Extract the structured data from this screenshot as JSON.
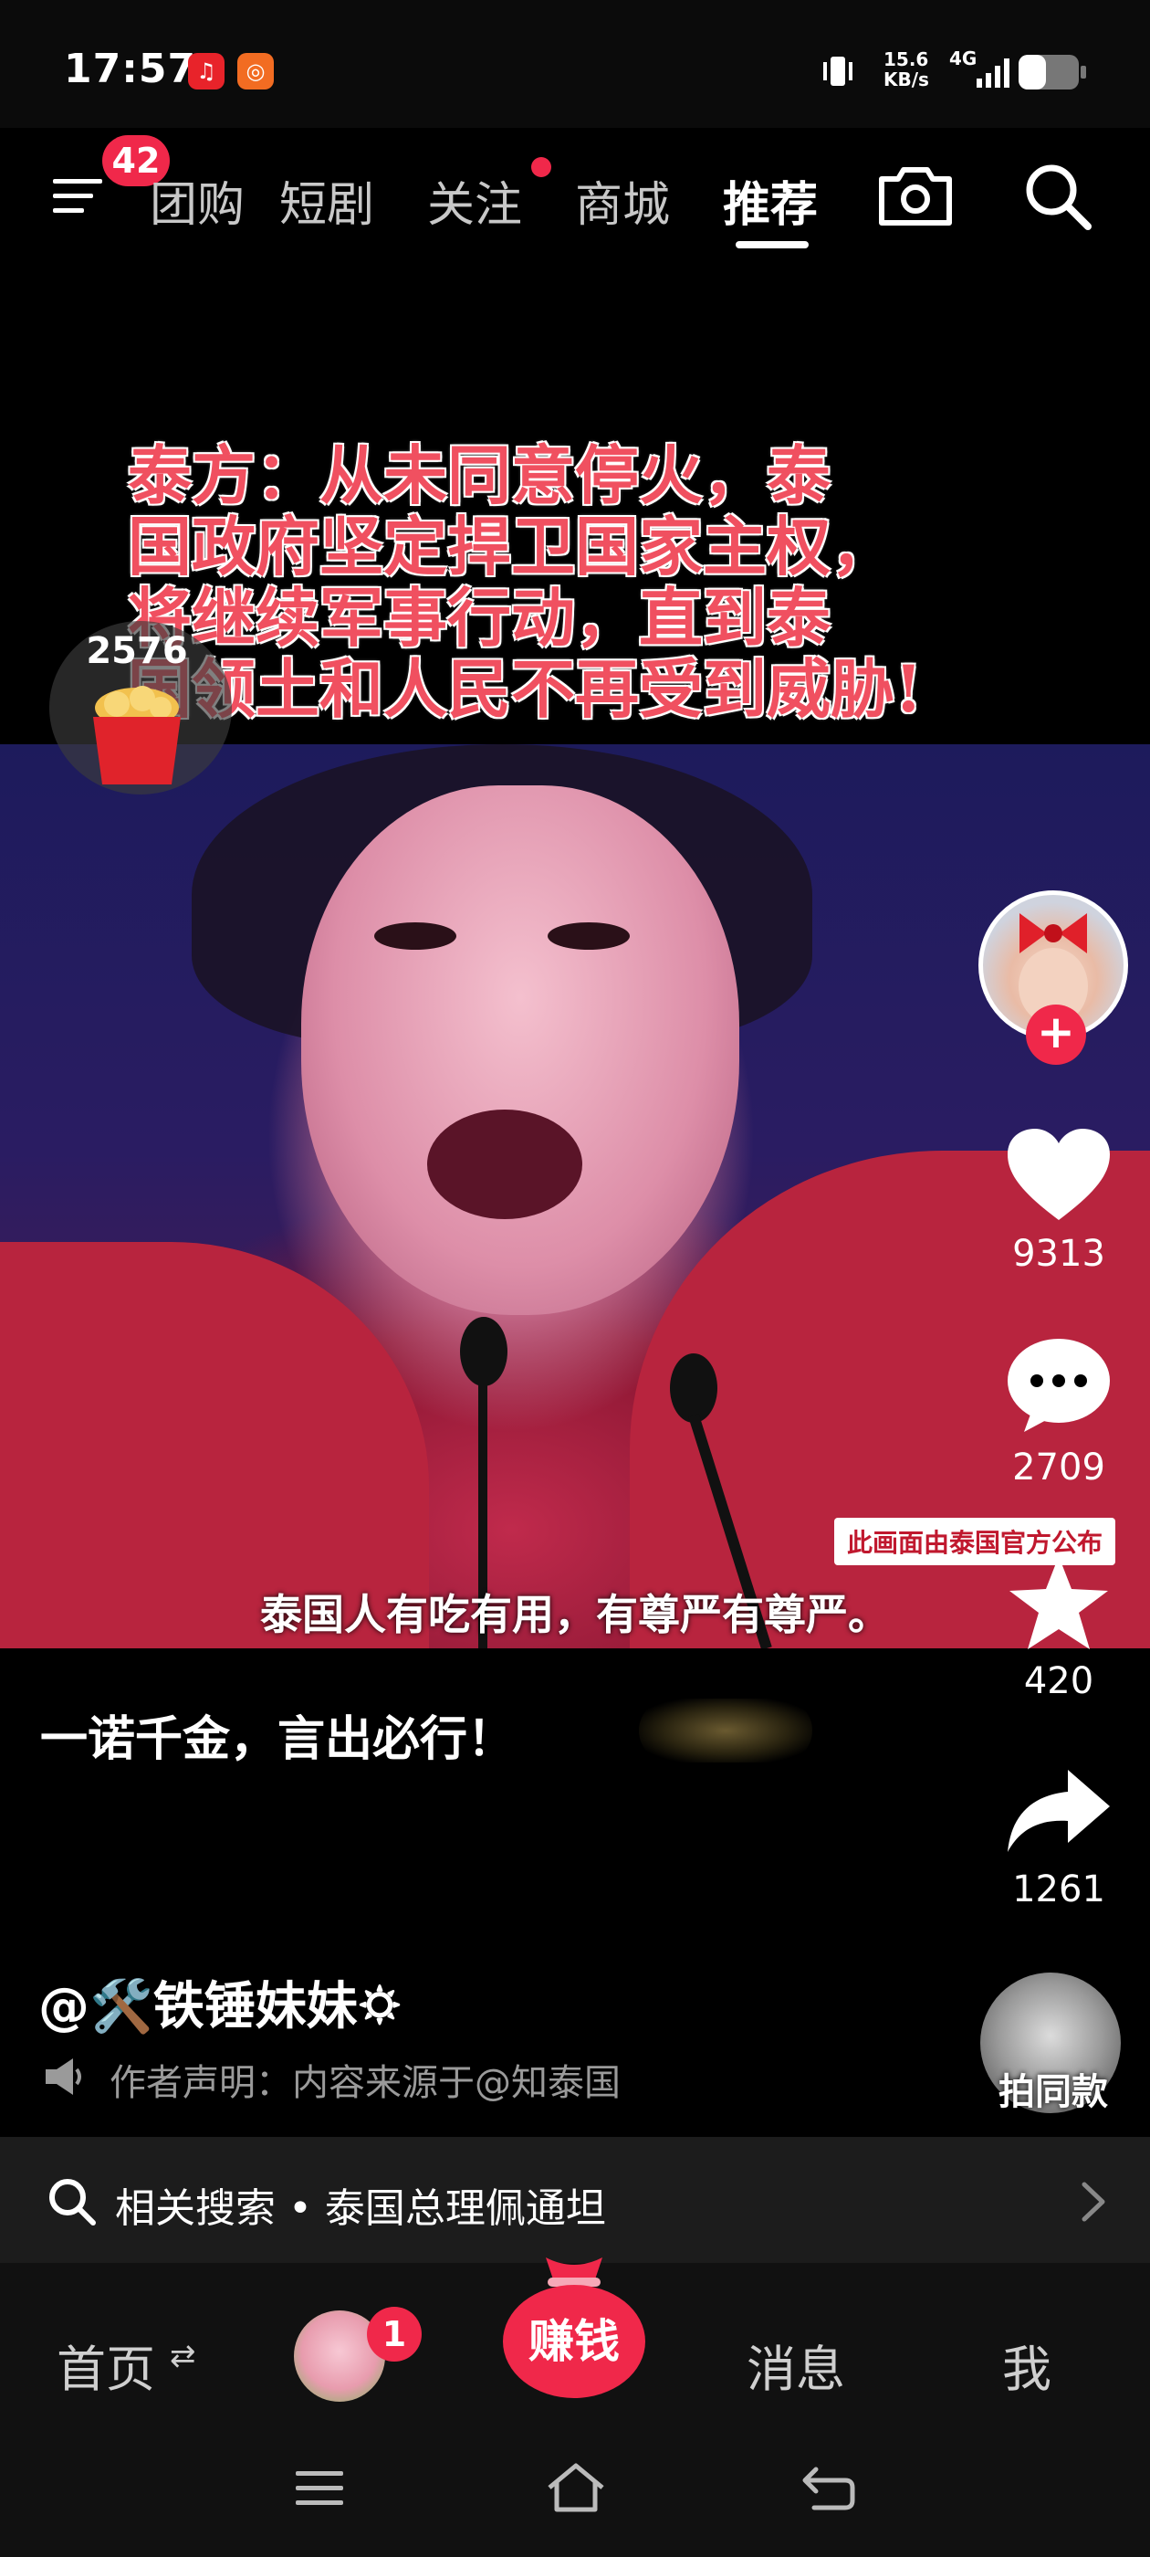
{
  "status_bar": {
    "time": "17:57",
    "net_speed_value": "15.6",
    "net_speed_unit": "KB/s",
    "network": "4G"
  },
  "top_nav": {
    "menu_badge": "42",
    "tabs": [
      "团购",
      "短剧",
      "关注",
      "商城",
      "推荐"
    ],
    "active_tab": "推荐"
  },
  "video": {
    "headline_lines": [
      "泰方：从未同意停火，泰",
      "国政府坚定捍卫国家主权，",
      "将继续军事行动，直到泰",
      "国领土和人民不再受到威胁!"
    ],
    "source_label": "此画面由泰国官方公布",
    "subtitle": "泰国人有吃有用，有尊严有尊严。",
    "caption": "一诺千金，言出必行！"
  },
  "coin_widget": {
    "count": "2576"
  },
  "actions": {
    "likes": "9313",
    "comments": "2709",
    "favorites": "420",
    "shares": "1261"
  },
  "author": {
    "name": "@🛠️铁锤妹妹🌣",
    "declaration": "作者声明：内容来源于@知泰国",
    "same_style_label": "拍同款"
  },
  "related_search": {
    "text": "相关搜索 • 泰国总理佩通坦"
  },
  "bottom_bar": {
    "home": "首页",
    "avatar_badge": "1",
    "earn": "赚钱",
    "messages": "消息",
    "me": "我"
  },
  "colors": {
    "accent": "#f0284a",
    "headline": "#f05060",
    "background": "#000000"
  },
  "icons": [
    "netease-icon",
    "vibrate-icon",
    "signal-icon",
    "battery-icon",
    "menu-icon",
    "camera-icon",
    "search-icon",
    "heart-icon",
    "comment-icon",
    "star-icon",
    "share-icon",
    "speaker-icon",
    "chevron-right-icon"
  ]
}
